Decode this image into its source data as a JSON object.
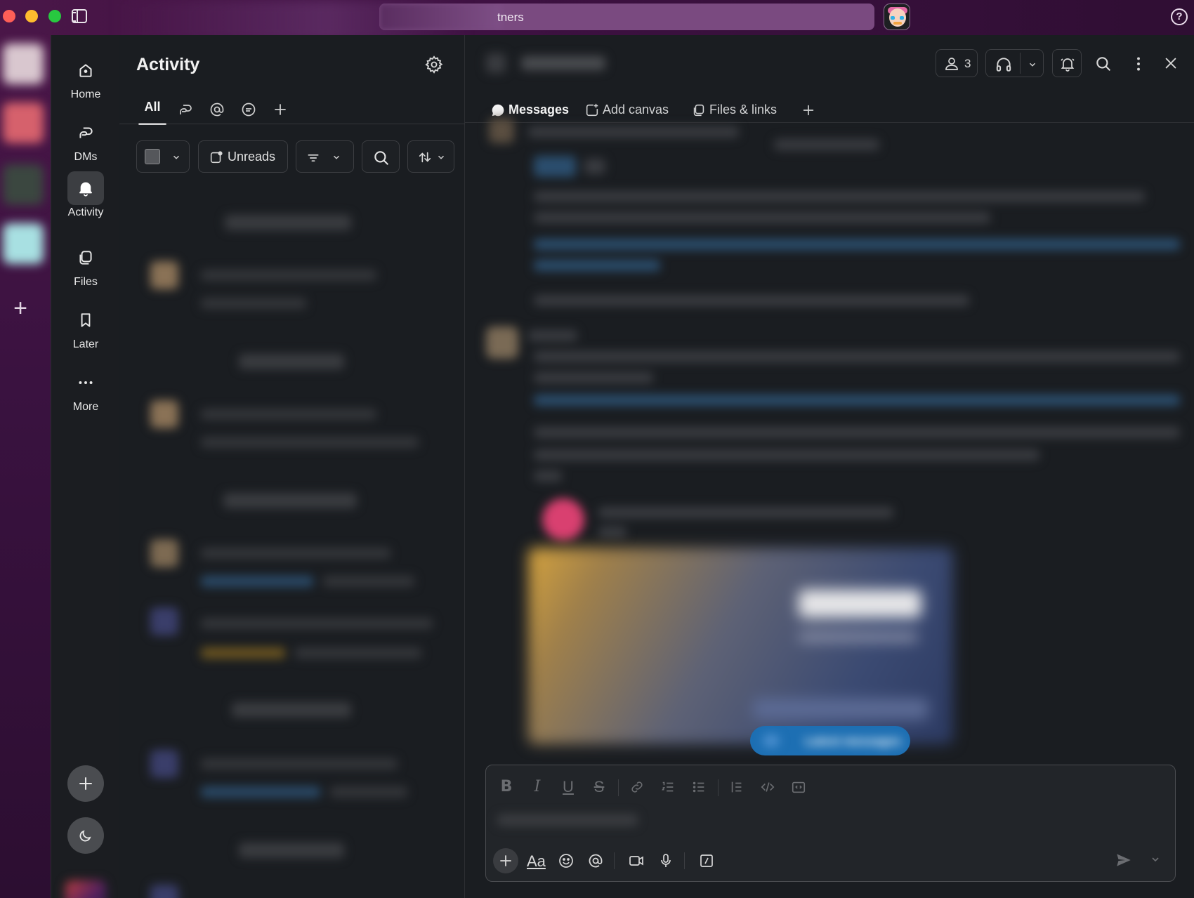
{
  "titlebar": {
    "search_text": "tners",
    "help_label": "?"
  },
  "nav": {
    "items": [
      {
        "label": "Home",
        "icon": "home-icon"
      },
      {
        "label": "DMs",
        "icon": "dms-icon"
      },
      {
        "label": "Activity",
        "icon": "bell-icon",
        "active": true
      },
      {
        "label": "Files",
        "icon": "files-icon"
      },
      {
        "label": "Later",
        "icon": "bookmark-icon"
      },
      {
        "label": "More",
        "icon": "more-icon"
      }
    ]
  },
  "activity": {
    "title": "Activity",
    "tabs": [
      {
        "label": "All",
        "active": true
      },
      {
        "icon": "threads-icon"
      },
      {
        "icon": "mention-icon"
      },
      {
        "icon": "reactions-icon"
      },
      {
        "icon": "add-icon"
      }
    ],
    "toolbar": {
      "unreads_label": "Unreads"
    }
  },
  "conversation": {
    "members_count": "3",
    "tabs": [
      {
        "label": "Messages",
        "active": true
      },
      {
        "label": "Add canvas"
      },
      {
        "label": "Files & links"
      }
    ],
    "latest_pill_label": "Latest messages"
  },
  "colors": {
    "accent": "#1d6fb3",
    "sidebar_bg": "#3b1238",
    "panel_bg": "#1a1d21"
  }
}
